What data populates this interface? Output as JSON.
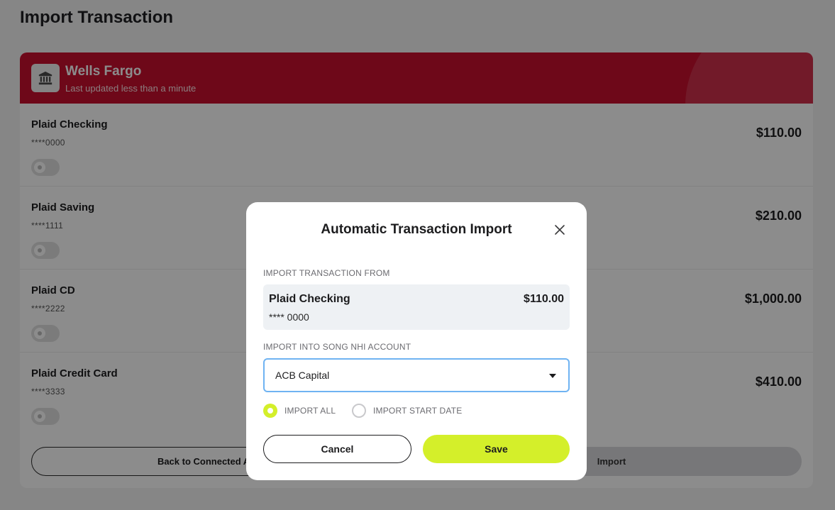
{
  "page": {
    "title": "Import Transaction"
  },
  "bank": {
    "name": "Wells Fargo",
    "subtitle": "Last updated less than a minute",
    "icon": "bank-icon",
    "color": "#c8102e"
  },
  "accounts": [
    {
      "name": "Plaid Checking",
      "mask": "****0000",
      "balance": "$110.00"
    },
    {
      "name": "Plaid Saving",
      "mask": "****1111",
      "balance": "$210.00"
    },
    {
      "name": "Plaid CD",
      "mask": "****2222",
      "balance": "$1,000.00"
    },
    {
      "name": "Plaid Credit Card",
      "mask": "****3333",
      "balance": "$410.00"
    }
  ],
  "footer": {
    "back_label": "Back to Connected Accounts",
    "import_label": "Import"
  },
  "modal": {
    "title": "Automatic Transaction Import",
    "from_label": "IMPORT TRANSACTION FROM",
    "source": {
      "name": "Plaid Checking",
      "balance": "$110.00",
      "mask": "**** 0000"
    },
    "into_label": "IMPORT INTO SONG NHI ACCOUNT",
    "selected_account": "ACB Capital",
    "radio_all": "IMPORT ALL",
    "radio_start": "IMPORT START DATE",
    "selected_radio": "IMPORT ALL",
    "cancel_label": "Cancel",
    "save_label": "Save",
    "accent_color": "#d4ef2a"
  }
}
